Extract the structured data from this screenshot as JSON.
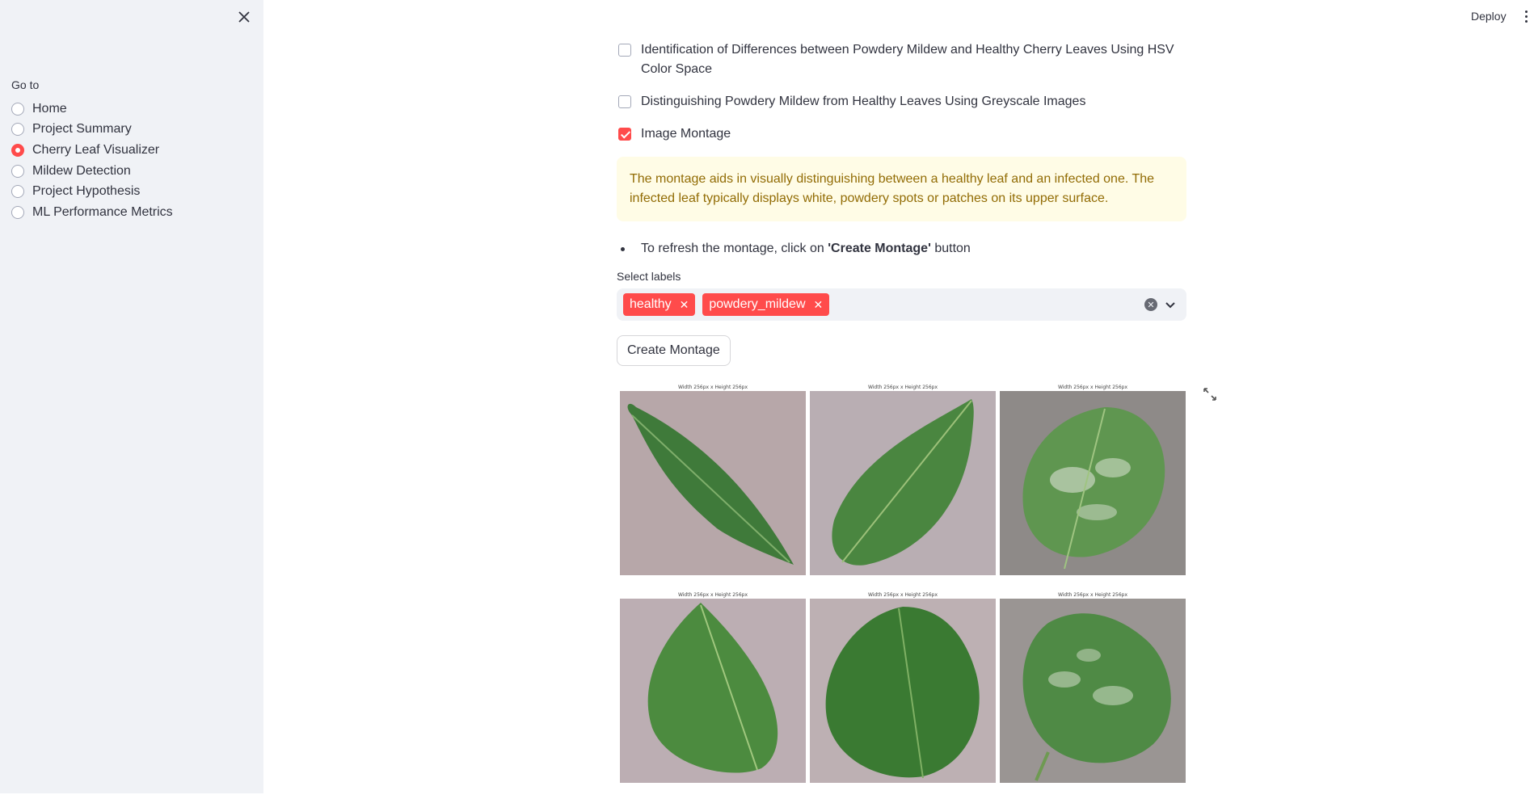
{
  "sidebar": {
    "heading": "Go to",
    "items": [
      {
        "label": "Home",
        "selected": false
      },
      {
        "label": "Project Summary",
        "selected": false
      },
      {
        "label": "Cherry Leaf Visualizer",
        "selected": true
      },
      {
        "label": "Mildew Detection",
        "selected": false
      },
      {
        "label": "Project Hypothesis",
        "selected": false
      },
      {
        "label": "ML Performance Metrics",
        "selected": false
      }
    ]
  },
  "header": {
    "deploy_label": "Deploy"
  },
  "main": {
    "checkboxes": [
      {
        "label": "Identification of Differences between Powdery Mildew and Healthy Cherry Leaves Using HSV Color Space",
        "checked": false
      },
      {
        "label": "Distinguishing Powdery Mildew from Healthy Leaves Using Greyscale Images",
        "checked": false
      },
      {
        "label": "Image Montage",
        "checked": true
      }
    ],
    "warning": "The montage aids in visually distinguishing between a healthy leaf and an infected one. The infected leaf typically displays white, powdery spots or patches on its upper surface.",
    "bullet": {
      "prefix": "To refresh the montage, click on ",
      "bold": "'Create Montage'",
      "suffix": " button"
    },
    "select_label": "Select labels",
    "tags": [
      "healthy",
      "powdery_mildew"
    ],
    "create_button": "Create Montage"
  },
  "montage": {
    "caption": "Width 256px x Height 256px",
    "images": [
      {
        "label": "healthy",
        "kind": "healthy"
      },
      {
        "label": "healthy",
        "kind": "healthy"
      },
      {
        "label": "powdery_mildew",
        "kind": "mildew"
      },
      {
        "label": "healthy",
        "kind": "healthy"
      },
      {
        "label": "healthy",
        "kind": "healthy"
      },
      {
        "label": "powdery_mildew",
        "kind": "mildew"
      }
    ]
  },
  "colors": {
    "accent": "#ff4b4b",
    "sidebar_bg": "#f0f2f6",
    "warning_bg": "#fffce6",
    "warning_text": "#926c05"
  }
}
